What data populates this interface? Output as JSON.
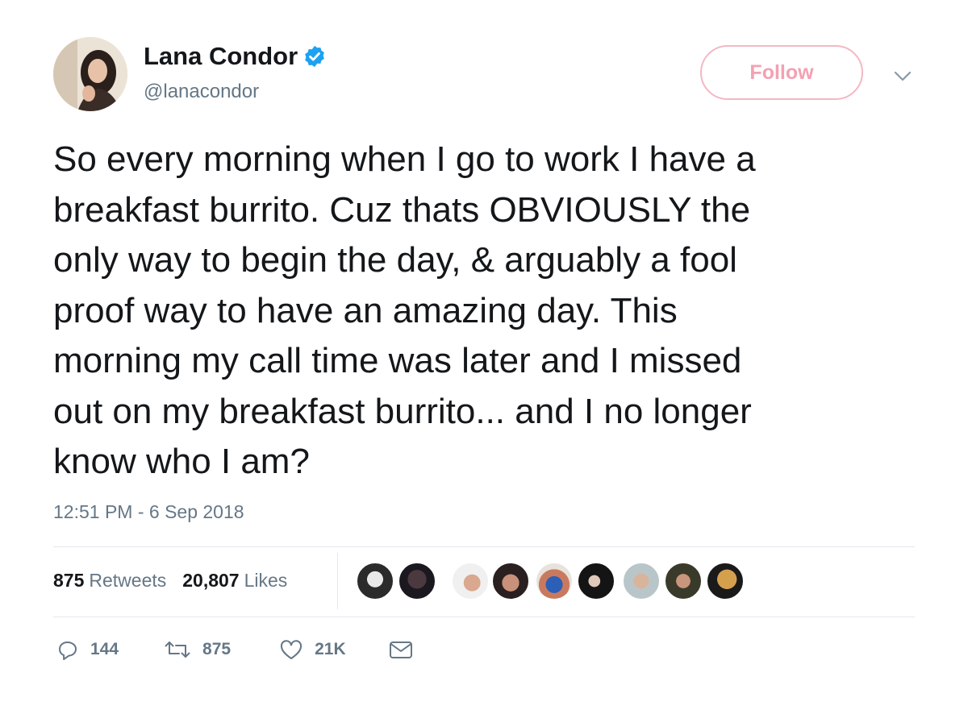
{
  "tweet": {
    "author": {
      "display_name": "Lana Condor",
      "handle": "@lanacondor",
      "verified": true
    },
    "follow_label": "Follow",
    "text": "So every morning when I go to work I have a\nbreakfast burrito. Cuz thats OBVIOUSLY the\nonly way to begin the day, & arguably a fool\nproof way to have an amazing day. This\nmorning my call time was later and I missed\nout on my breakfast burrito... and I no longer\nknow who I am?",
    "timestamp": "12:51 PM - 6 Sep 2018",
    "stats": {
      "retweets_count": "875",
      "retweets_label": "Retweets",
      "likes_count": "20,807",
      "likes_label": "Likes"
    },
    "actions": {
      "replies": "144",
      "retweets": "875",
      "likes": "21K"
    }
  },
  "colors": {
    "text_primary": "#14171a",
    "text_secondary": "#657786",
    "verified_blue": "#1da1f2",
    "follow_pink": "#f3a1b3",
    "divider": "#e1e8ed"
  },
  "icons": {
    "verified": "verified-badge-icon",
    "more": "chevron-down-icon",
    "reply": "reply-icon",
    "retweet": "retweet-icon",
    "like": "heart-icon",
    "message": "envelope-icon"
  }
}
